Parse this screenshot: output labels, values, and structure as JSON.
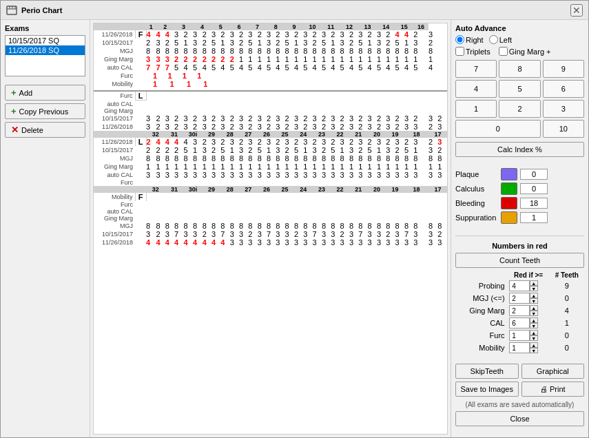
{
  "window": {
    "title": "Perio Chart",
    "close_label": "✕"
  },
  "exams": {
    "label": "Exams",
    "items": [
      {
        "label": "10/15/2017  SQ",
        "selected": false
      },
      {
        "label": "11/26/2018  SQ",
        "selected": true
      }
    ]
  },
  "buttons": {
    "add": "Add",
    "copy_previous": "Copy Previous",
    "delete": "Delete"
  },
  "auto_advance": {
    "title": "Auto Advance",
    "right_label": "Right",
    "left_label": "Left",
    "triplets_label": "Triplets",
    "ging_marg_label": "Ging Marg +"
  },
  "numpad": {
    "keys": [
      "7",
      "8",
      "9",
      "4",
      "5",
      "6",
      "1",
      "2",
      "3",
      "0",
      "10"
    ]
  },
  "calc_index": "Calc Index %",
  "indicators": [
    {
      "label": "Plaque",
      "color": "#7b68ee",
      "value": "0"
    },
    {
      "label": "Calculus",
      "color": "#00aa00",
      "value": "0"
    },
    {
      "label": "Bleeding",
      "color": "#dd0000",
      "value": "18"
    },
    {
      "label": "Suppuration",
      "color": "#e8a000",
      "value": "1"
    }
  ],
  "numbers_in_red": {
    "title": "Numbers in red",
    "count_teeth_btn": "Count Teeth",
    "col_red_if": "Red if >=",
    "col_teeth": "# Teeth",
    "rows": [
      {
        "label": "Probing",
        "red_if": "4",
        "teeth": "9"
      },
      {
        "label": "MGJ (<=)",
        "red_if": "2",
        "teeth": "0"
      },
      {
        "label": "Ging Marg",
        "red_if": "2",
        "teeth": "4"
      },
      {
        "label": "CAL",
        "red_if": "6",
        "teeth": "1"
      },
      {
        "label": "Furc",
        "red_if": "1",
        "teeth": "0"
      },
      {
        "label": "Mobility",
        "red_if": "1",
        "teeth": "0"
      }
    ]
  },
  "bottom_buttons": {
    "skip_teeth": "SkipTeeth",
    "graphical": "Graphical",
    "save_to_images": "Save to Images",
    "print": "Print",
    "auto_save_text": "(All exams are saved automatically)",
    "close": "Close"
  },
  "chart": {
    "upper_teeth": [
      "1",
      "2",
      "3",
      "4",
      "5",
      "6",
      "7",
      "8",
      "9",
      "10",
      "11",
      "12",
      "13",
      "14",
      "15",
      "16"
    ],
    "lower_teeth": [
      "32",
      "31",
      "30i",
      "29",
      "28",
      "27",
      "26",
      "25",
      "24",
      "23",
      "22",
      "21",
      "20",
      "19",
      "18",
      "17"
    ],
    "upper_section": {
      "rows": [
        {
          "label": "11/26/2018",
          "side": "",
          "data": "4 4 4 3 2 3 2 3 2 3 2 3 2 3 2 3 2 3 2 3 2 3 2 3 2 3 2 3 4 4 2 3",
          "hasRed": true
        },
        {
          "label": "10/15/2017",
          "side": "",
          "data": "2 3 2 5 1 3 2 5 1 3 2 5 1 3 2 5 1 3 2 5 1 3 2 5 1 3 2 5 1 3 2 5"
        },
        {
          "label": "MGJ",
          "side": "",
          "data": "8 8 8 8 8 8 8 8 8 8 8 8 8 8 8 8 8 8 8 8 8 8 8 8 8 8 8 8 8 8 8 8"
        },
        {
          "label": "Ging Marg",
          "side": "",
          "data": "3 3 3 2 2 2 2 2 2 2",
          "hasRed": true
        },
        {
          "label": "auto CAL",
          "side": "",
          "data": "7 7 7 5 4 5 4 5 4 4",
          "hasRed": true
        },
        {
          "label": "Furc",
          "side": "",
          "data": ""
        },
        {
          "label": "Mobility",
          "side": "",
          "data": "1    1    1    1"
        }
      ]
    },
    "lower_section": {
      "rows": [
        {
          "label": "Furc",
          "data": ""
        },
        {
          "label": "auto CAL",
          "data": ""
        },
        {
          "label": "Ging Marg",
          "data": ""
        },
        {
          "label": "10/15/2017",
          "data": "3 2 3 2 3 2 3 2 3 2 3 2 3 2 3 2 3 2 3 2 3 2 3 2 3 2 3 2 3 2 3 2"
        },
        {
          "label": "11/26/2018",
          "data": "3 2 3 2 3 2 3 2 3 2 3 2 3 2 3 2 3 2 3 2 3 2 3 2 3 2 3 2 3 3 2 3"
        }
      ]
    }
  }
}
